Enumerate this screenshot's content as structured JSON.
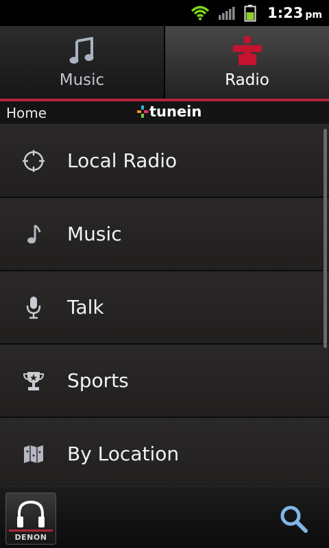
{
  "status_bar": {
    "time": "1:23",
    "ampm": "pm",
    "icons": [
      "wifi-icon",
      "signal-icon",
      "battery-icon"
    ]
  },
  "tabs": [
    {
      "label": "Music",
      "icon": "music-note-icon",
      "active": false
    },
    {
      "label": "Radio",
      "icon": "tunein-radio-icon",
      "active": true
    }
  ],
  "breadcrumb": {
    "home": "Home",
    "brand": "tunein"
  },
  "list": {
    "items": [
      {
        "label": "Local Radio",
        "icon": "crosshair-icon"
      },
      {
        "label": "Music",
        "icon": "music-note-icon"
      },
      {
        "label": "Talk",
        "icon": "microphone-icon"
      },
      {
        "label": "Sports",
        "icon": "trophy-icon"
      },
      {
        "label": "By Location",
        "icon": "map-icon"
      }
    ]
  },
  "footer": {
    "brand_button": "DENON",
    "search": "search-icon"
  },
  "colors": {
    "accent": "#b3233c",
    "wifi": "#7cd41f",
    "battery": "#8ccf2a"
  }
}
